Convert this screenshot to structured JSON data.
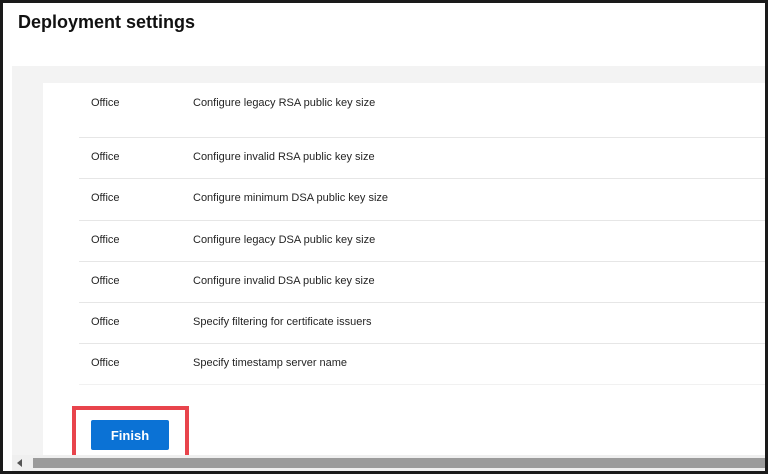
{
  "header": {
    "title": "Deployment settings"
  },
  "settings": {
    "rows": [
      {
        "category": "Office",
        "setting": "Configure legacy RSA public key size"
      },
      {
        "category": "Office",
        "setting": "Configure invalid RSA public key size"
      },
      {
        "category": "Office",
        "setting": "Configure minimum DSA public key size"
      },
      {
        "category": "Office",
        "setting": "Configure legacy DSA public key size"
      },
      {
        "category": "Office",
        "setting": "Configure invalid DSA public key size"
      },
      {
        "category": "Office",
        "setting": "Specify filtering for certificate issuers"
      },
      {
        "category": "Office",
        "setting": "Specify timestamp server name"
      }
    ]
  },
  "actions": {
    "finish_label": "Finish"
  },
  "colors": {
    "primary": "#0b72d5",
    "highlight": "#e8444c"
  }
}
